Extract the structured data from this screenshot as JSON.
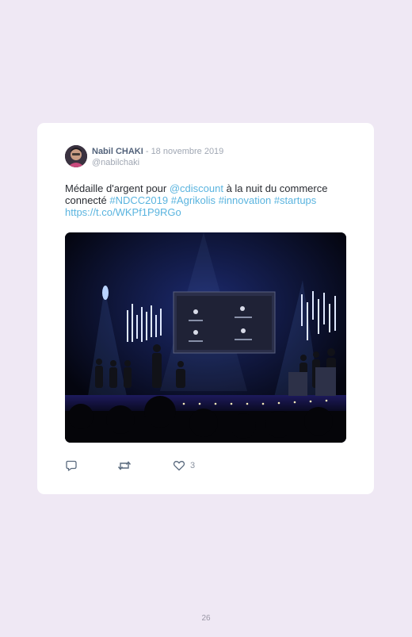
{
  "tweet": {
    "author_name": "Nabil CHAKI",
    "separator": " - ",
    "date": "18 novembre 2019",
    "handle": "@nabilchaki",
    "text_parts": {
      "p1": "Médaille d'argent pour ",
      "mention": "@cdiscount",
      "p2": " à la nuit du commerce connecté ",
      "tag1": "#NDCC2019",
      "tag2": "#Agrikolis",
      "tag3": "#innovation",
      "tag4": "#startups",
      "url": "https://t.co/WKPf1P9RGo"
    },
    "like_count": "3",
    "icons": {
      "reply": "reply-icon",
      "retweet": "retweet-icon",
      "like": "heart-icon"
    }
  },
  "page_number": "26",
  "colors": {
    "background": "#efe8f4",
    "card": "#ffffff",
    "link": "#5ab4df",
    "name": "#52627a",
    "muted": "#a0a7b3"
  }
}
